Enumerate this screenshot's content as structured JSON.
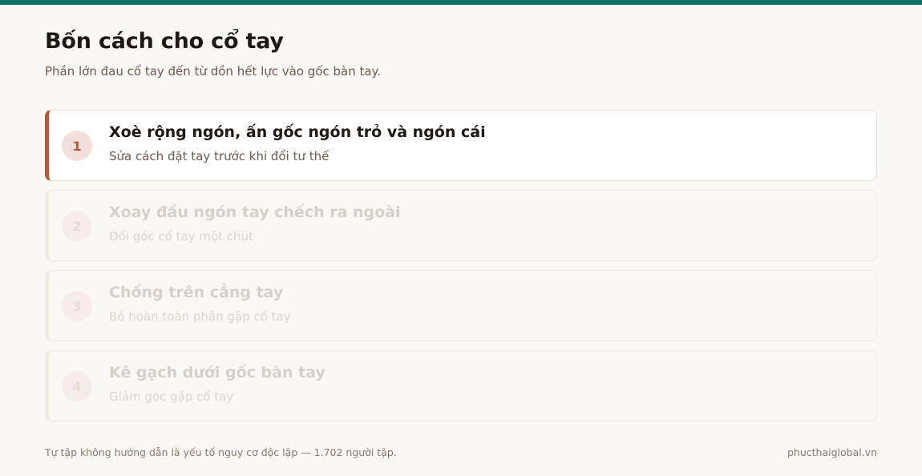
{
  "header": {
    "title": "Bốn cách cho cổ tay",
    "subtitle": "Phần lớn đau cổ tay đến từ dồn hết lực vào gốc bàn tay."
  },
  "steps": [
    {
      "number": "1",
      "title": "Xoè rộng ngón, ấn gốc ngón trỏ và ngón cái",
      "description": "Sửa cách đặt tay trước khi đổi tư thế",
      "active": true
    },
    {
      "number": "2",
      "title": "Xoay đầu ngón tay chếch ra ngoài",
      "description": "Đổi góc cổ tay một chút",
      "active": false
    },
    {
      "number": "3",
      "title": "Chống trên cẳng tay",
      "description": "Bỏ hoàn toàn phần gập cổ tay",
      "active": false
    },
    {
      "number": "4",
      "title": "Kê gạch dưới gốc bàn tay",
      "description": "Giảm góc gập cổ tay",
      "active": false
    }
  ],
  "footer": {
    "note": "Tự tập không hướng dẫn là yếu tố nguy cơ độc lập — 1.702 người tập.",
    "domain": "phucthaiglobal.vn"
  },
  "colors": {
    "top_bar": "#0f7569",
    "accent": "#b25a3b",
    "background": "#faf8f4"
  }
}
